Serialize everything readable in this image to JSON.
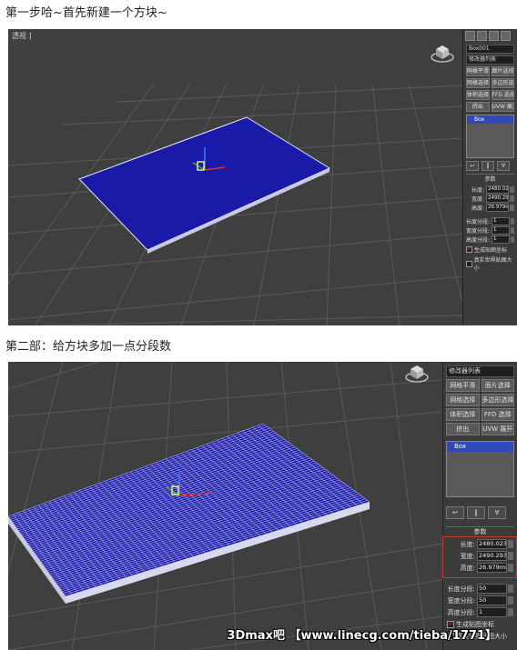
{
  "step1": {
    "caption": "第一步哈~首先新建一个方块~",
    "viewport_label": "透视 ]",
    "panel": {
      "object_name": "Box001",
      "modifier_list": "修改器列表",
      "buttons": [
        "网格平滑",
        "面片选择",
        "网格选择",
        "多边形选择",
        "体积选择",
        "FFD 选择",
        "挤出",
        "UVW 展开"
      ],
      "stack_item": "Box",
      "rollout": "参数",
      "params": [
        {
          "label": "长度:",
          "value": "2480.023"
        },
        {
          "label": "宽度:",
          "value": "2490.293"
        },
        {
          "label": "高度:",
          "value": "26.979mm"
        },
        {
          "label": "长度分段:",
          "value": "1"
        },
        {
          "label": "宽度分段:",
          "value": "1"
        },
        {
          "label": "高度分段:",
          "value": "1"
        }
      ],
      "check1": "生成贴图坐标",
      "check2": "真实世界贴图大小"
    }
  },
  "step2": {
    "caption": "第二部：给方块多加一点分段数",
    "panel": {
      "modifier_list": "修改器列表",
      "buttons": [
        "网格平滑",
        "面片选择",
        "网格选择",
        "多边形选择",
        "体积选择",
        "FFD 选择",
        "挤出",
        "UVW 展开"
      ],
      "stack_item": "Box",
      "rollout": "参数",
      "params": [
        {
          "label": "长度:",
          "value": "2480.023"
        },
        {
          "label": "宽度:",
          "value": "2490.293"
        },
        {
          "label": "高度:",
          "value": "26.979mm"
        },
        {
          "label": "长度分段:",
          "value": "50"
        },
        {
          "label": "宽度分段:",
          "value": "50"
        },
        {
          "label": "高度分段:",
          "value": "1"
        }
      ],
      "check1": "生成贴图坐标",
      "check2": "真实世界贴图大小"
    },
    "watermark": "3Dmax吧 【www.linecg.com/tieba/1771】"
  },
  "colors": {
    "box_blue": "#1a1aa8",
    "box_edge": "#e8e8ff",
    "viewport_bg": "#3f3f3f",
    "highlight": "#c0392b"
  }
}
